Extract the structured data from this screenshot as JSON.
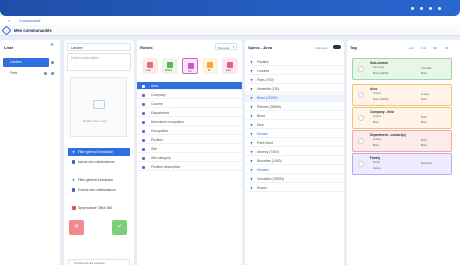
{
  "breadcrumb": {
    "back": "«",
    "current": "Communauté"
  },
  "title": "Mes communautés",
  "colors": {
    "accent": "#2f6fe0",
    "brand": "#2a66d1",
    "danger": "#f08a8f",
    "success": "#7dd07a"
  },
  "col1": {
    "header": "Liste",
    "add_label": "+",
    "items": [
      {
        "label": "Londres"
      },
      {
        "label": "Paris"
      }
    ]
  },
  "col2": {
    "name_value": "Londres",
    "desc_placeholder": "Entrer a description",
    "image_caption": "Modifier votre image",
    "filter1_label": "Filtre général d'exclusion",
    "filter1_sub": "Inclure des collaborateurs",
    "filter2_label": "Filtre général d'exclusion",
    "filter2_sub": "Exclure des collaborateurs",
    "sync_label": "Synchroniser Office 365",
    "bottom_label": "Synchroniser les membres"
  },
  "col3": {
    "header": "Rubric",
    "select_value": "Personal",
    "icons": [
      {
        "label": "User"
      },
      {
        "label": "Mobile"
      },
      {
        "label": "Job"
      },
      {
        "label": "IR"
      },
      {
        "label": "Date"
      }
    ],
    "items": [
      {
        "label": "Area",
        "selected": true
      },
      {
        "label": "Company"
      },
      {
        "label": "Country"
      },
      {
        "label": "Department"
      },
      {
        "label": "Normative occupation"
      },
      {
        "label": "Occupation"
      },
      {
        "label": "Position"
      },
      {
        "label": "Site"
      },
      {
        "label": "Site category"
      },
      {
        "label": "Position description"
      }
    ]
  },
  "col4": {
    "header": "Specs - Area",
    "toggle_label": "Inclu open",
    "items": [
      {
        "label": "Position"
      },
      {
        "label": "Londres"
      },
      {
        "label": "Paris (750)"
      },
      {
        "label": "Marseille (130)"
      },
      {
        "label": "Brest (29200)",
        "highlight": true
      },
      {
        "label": "Rennes (35000)"
      },
      {
        "label": "Brest"
      },
      {
        "label": "Nice"
      },
      {
        "label": "Monad",
        "highlight": true
      },
      {
        "label": "Paris Nord"
      },
      {
        "label": "Annecy (7400)"
      },
      {
        "label": "Bruxelles (1000)"
      },
      {
        "label": "Monaco",
        "highlight": true
      },
      {
        "label": "Versailles (78000)"
      },
      {
        "label": "Rouen"
      }
    ]
  },
  "col5": {
    "header": "Tag",
    "icon_labels": [
      "A-C",
      "C-A",
      "Sfil",
      "IR"
    ],
    "tags": [
      {
        "name": "Sub-control",
        "items": [
          "PC (cost)",
          "Brest (29200)",
          "Grenoble",
          "Brest"
        ],
        "color": "#e8f5e9",
        "border": "#9fd6a2"
      },
      {
        "name": "Area",
        "items": [
          "France",
          "Brest (29200)",
          "France",
          "Brest"
        ],
        "color": "#fff4e5",
        "border": "#f2c27d"
      },
      {
        "name": "Company - field",
        "items": [
          "France",
          "Brest",
          "Brest",
          "Brest"
        ],
        "color": "#fff4e5",
        "border": "#f2c27d"
      },
      {
        "name": "Department - contact(s)",
        "items": [
          "France",
          "Brest",
          "Brest",
          "Brest"
        ],
        "color": "#fdeaea",
        "border": "#f0a9a9"
      },
      {
        "name": "Family",
        "items": [
          "Fiscal",
          "Ancien",
          "Mercedes"
        ],
        "color": "#efeafd",
        "border": "#b9a8f0"
      }
    ]
  }
}
